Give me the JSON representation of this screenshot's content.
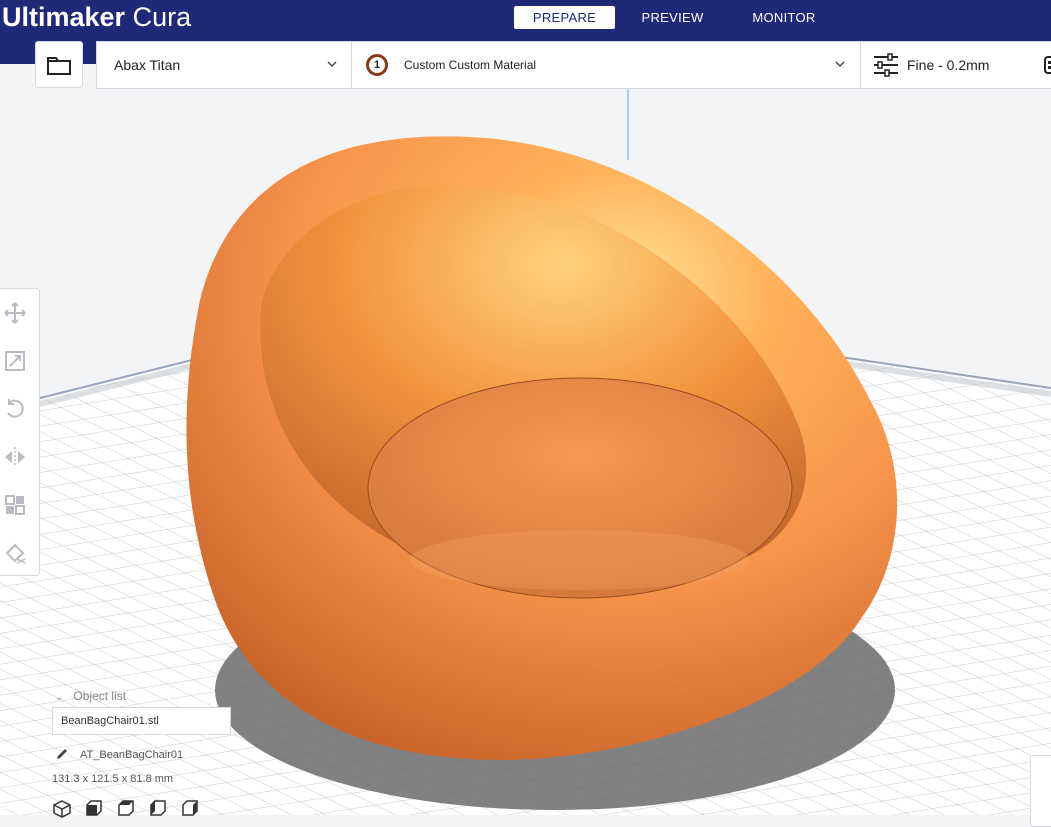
{
  "app": {
    "title_bold": "Ultimaker",
    "title_light": " Cura"
  },
  "tabs": [
    {
      "label": "PREPARE",
      "active": true
    },
    {
      "label": "PREVIEW",
      "active": false
    },
    {
      "label": "MONITOR",
      "active": false
    }
  ],
  "toolbar": {
    "open_icon": "folder-icon",
    "printer": "Abax Titan",
    "extruder_number": "1",
    "material": "Custom Custom Material",
    "quality": "Fine - 0.2mm",
    "quality_icon": "sliders-icon"
  },
  "tools": [
    {
      "name": "move-icon"
    },
    {
      "name": "scale-icon"
    },
    {
      "name": "rotate-icon"
    },
    {
      "name": "mirror-icon"
    },
    {
      "name": "per-model-settings-icon"
    },
    {
      "name": "support-blocker-icon"
    }
  ],
  "object_list": {
    "header": "Object list",
    "file": "BeanBagChair01.stl",
    "object_name": "AT_BeanBagChair01",
    "dimensions": "131.3 x 121.5 x 81.8 mm"
  },
  "colors": {
    "header_bg": "#1e2a78",
    "model": "#f7924a",
    "build_plate": "#ffffff",
    "grid": "#bfc3c9"
  }
}
